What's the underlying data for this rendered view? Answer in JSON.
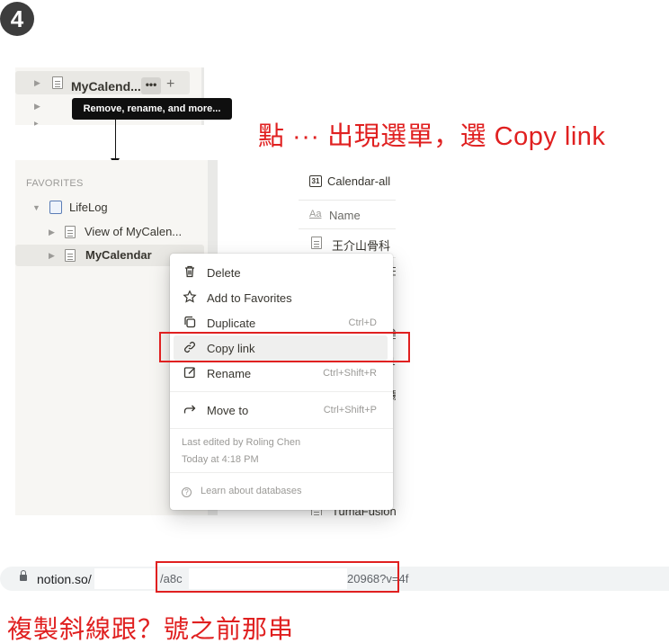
{
  "step": {
    "number": "4"
  },
  "top_sidebar": {
    "page_label": "MyCalend...",
    "more_dots": "•••",
    "add": "+"
  },
  "tooltip": {
    "text": "Remove, rename, and more..."
  },
  "instruction_top": "點 ··· 出現選單，選 Copy link",
  "sidebar": {
    "favorites_header": "FAVORITES",
    "items": [
      {
        "label": "LifeLog"
      },
      {
        "label": "View of MyCalen..."
      },
      {
        "label": "MyCalendar"
      }
    ]
  },
  "table": {
    "db_title": "Calendar-all",
    "name_header": "Name",
    "name_icon_text": "Aa",
    "calendar_icon_text": "31",
    "first_row": "王介山骨科",
    "last_row": "TumaFusion"
  },
  "context_menu": {
    "items": [
      {
        "label": "Delete",
        "shortcut": "",
        "icon": "trash-icon"
      },
      {
        "label": "Add to Favorites",
        "shortcut": "",
        "icon": "star-icon"
      },
      {
        "label": "Duplicate",
        "shortcut": "Ctrl+D",
        "icon": "duplicate-icon"
      },
      {
        "label": "Copy link",
        "shortcut": "",
        "icon": "link-icon"
      },
      {
        "label": "Rename",
        "shortcut": "Ctrl+Shift+R",
        "icon": "rename-icon"
      },
      {
        "label": "Move to",
        "shortcut": "Ctrl+Shift+P",
        "icon": "move-arrow-icon"
      }
    ],
    "last_edited": "Last edited by Roling Chen",
    "edited_time": "Today at 4:18 PM",
    "learn": "Learn about databases"
  },
  "url_bar": {
    "domain": "notion.so/",
    "id_start": "/a8c",
    "id_end": "20968?v=4f"
  },
  "instruction_bottom": "複製斜線跟？號之前那串",
  "colors": {
    "annotation": "#e02020",
    "sidebar_bg": "#f7f6f3",
    "text": "#37352f"
  }
}
